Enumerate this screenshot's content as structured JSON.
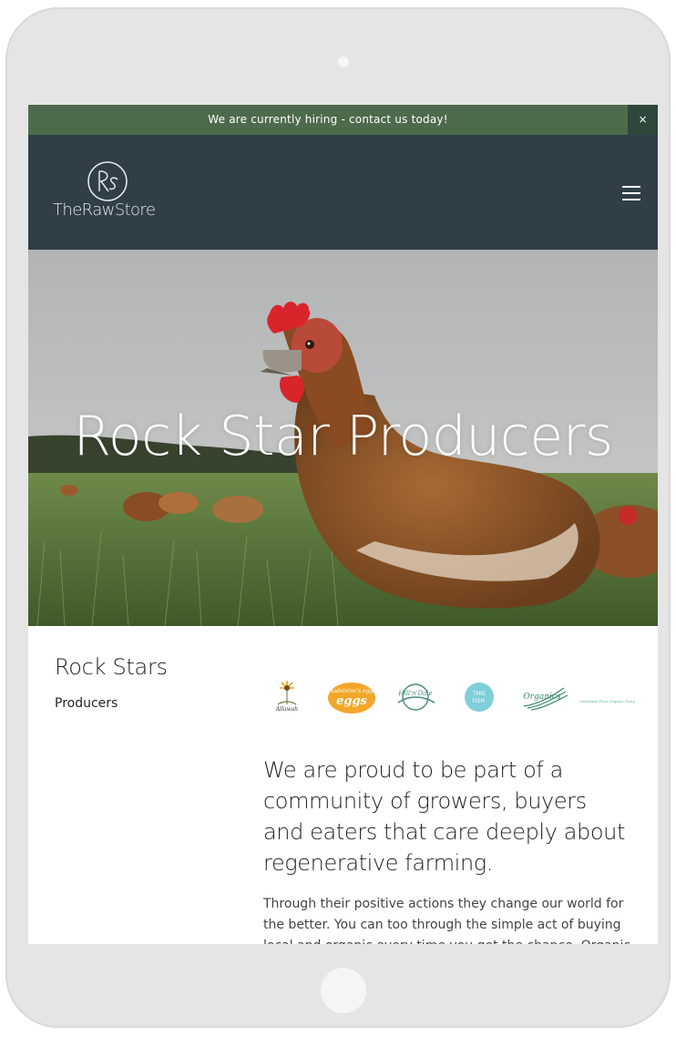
{
  "announcement": {
    "text": "We are currently hiring - contact us today!",
    "close_label": "×"
  },
  "header": {
    "logo_monogram": "RS",
    "logo_text": "TheRawStore",
    "menu_icon": "hamburger-menu-icon"
  },
  "hero": {
    "title": "Rock Star Producers"
  },
  "sidebar": {
    "title": "Rock Stars",
    "subtitle": "Producers"
  },
  "producer_logos": [
    {
      "name": "sunflower-producer-logo",
      "text": "Allawah"
    },
    {
      "name": "madeleines-eggs-logo",
      "text": "Madeleine's eggs"
    },
    {
      "name": "hill-n-dale-logo",
      "text": "Hill'n'Dale"
    },
    {
      "name": "this-fish-logo",
      "text": "THIS FISH."
    },
    {
      "name": "organics-logo",
      "text": "Organics"
    },
    {
      "name": "script-producer-logo",
      "text": "Mountain Pure Organic Dairy"
    }
  ],
  "main": {
    "lead": "We are proud to be part of a community of growers, buyers and eaters that care deeply about regenerative farming.",
    "body": "Through their positive actions they change our world for the better. You can too through the simple act of buying local and organic every time you get the chance. Organic farming"
  },
  "colors": {
    "announcement_bg": "#4d6b4c",
    "header_bg": "#303e48",
    "eggs_orange": "#f2a62a",
    "teal": "#4fb5a8"
  }
}
